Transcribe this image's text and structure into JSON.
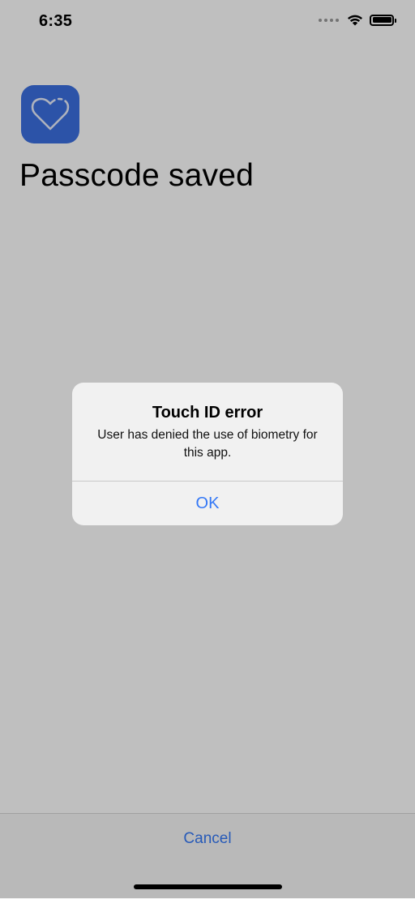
{
  "status_bar": {
    "time": "6:35",
    "icons": [
      "signal-dots-icon",
      "wifi-icon",
      "battery-icon"
    ]
  },
  "app": {
    "icon": "heart-icon",
    "brand_color": "#3b6fe0",
    "title": "Passcode saved"
  },
  "bottom_bar": {
    "cancel_label": "Cancel"
  },
  "alert": {
    "title": "Touch ID error",
    "message": "User has denied the use of biometry for this app.",
    "ok_label": "OK"
  },
  "colors": {
    "accent": "#3478f6",
    "overlay": "rgba(0,0,0,0.25)"
  }
}
